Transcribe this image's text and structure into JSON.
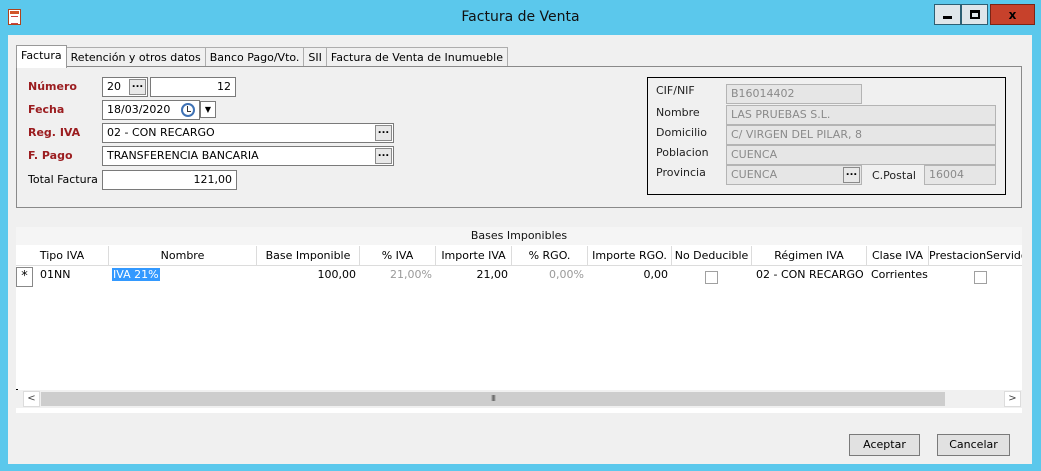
{
  "window": {
    "title": "Factura de Venta",
    "minimize": "minimize",
    "maximize": "maximize",
    "close": "x"
  },
  "tabs": [
    {
      "label": "Factura"
    },
    {
      "label": "Retención y otros datos"
    },
    {
      "label": "Banco Pago/Vto."
    },
    {
      "label": "SII"
    },
    {
      "label": "Factura de Venta de Inumueble"
    }
  ],
  "form": {
    "numero_label": "Número",
    "numero_serie": "20",
    "numero_valor": "12",
    "fecha_label": "Fecha",
    "fecha_valor": "18/03/2020",
    "reg_iva_label": "Reg. IVA",
    "reg_iva_valor": "02 - CON RECARGO",
    "f_pago_label": "F. Pago",
    "f_pago_valor": "TRANSFERENCIA BANCARIA",
    "total_label": "Total Factura",
    "total_valor": "121,00",
    "dots": "..."
  },
  "cliente": {
    "cif_label": "CIF/NIF",
    "cif_valor": "B16014402",
    "nombre_label": "Nombre",
    "nombre_valor": "LAS PRUEBAS S.L.",
    "domicilio_label": "Domicilio",
    "domicilio_valor": "C/ VIRGEN DEL PILAR, 8",
    "poblacion_label": "Poblacion",
    "poblacion_valor": "CUENCA",
    "provincia_label": "Provincia",
    "provincia_valor": "CUENCA",
    "cpostal_label": "C.Postal",
    "cpostal_valor": "16004"
  },
  "grid": {
    "caption": "Bases Imponibles",
    "columns": [
      "Tipo IVA",
      "Nombre",
      "Base Imponible",
      "% IVA",
      "Importe IVA",
      "% RGO.",
      "Importe RGO.",
      "No Deducible",
      "Régimen IVA",
      "Clase IVA",
      "PrestacionServidos"
    ],
    "row": {
      "marker": "*",
      "tipo_iva": "01NN",
      "nombre": "IVA 21%",
      "base_imponible": "100,00",
      "pct_iva": "21,00%",
      "importe_iva": "21,00",
      "pct_rgo": "0,00%",
      "importe_rgo": "0,00",
      "regimen_iva": "02 - CON RECARGO",
      "clase_iva": "Corrientes"
    },
    "scroll_left": "<",
    "scroll_right": ">",
    "scroll_grip": "III"
  },
  "buttons": {
    "aceptar": "Aceptar",
    "cancelar": "Cancelar"
  }
}
